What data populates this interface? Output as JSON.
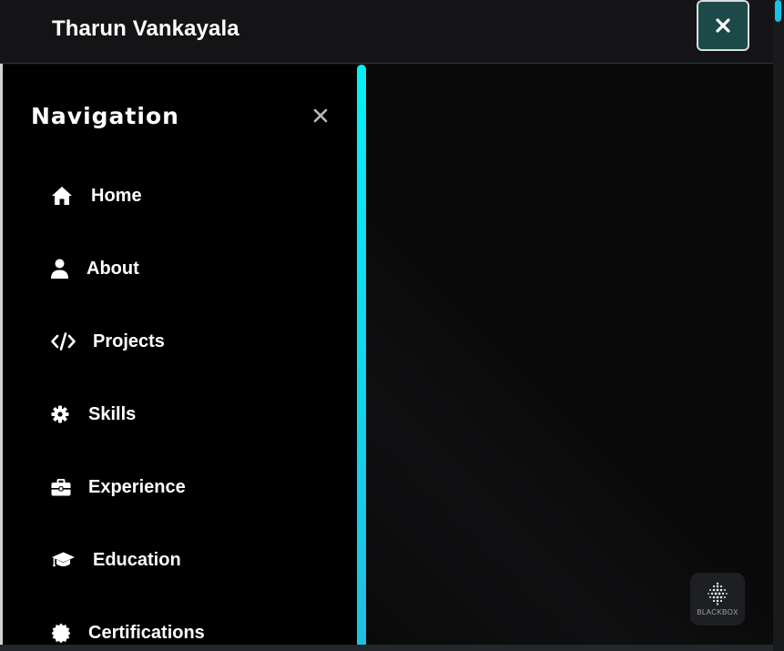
{
  "header": {
    "title": "Tharun Vankayala",
    "close_icon": "close-icon"
  },
  "sidebar": {
    "heading": "Navigation",
    "close_icon": "close-icon",
    "items": [
      {
        "label": "Home",
        "icon": "home-icon"
      },
      {
        "label": "About",
        "icon": "user-icon"
      },
      {
        "label": "Projects",
        "icon": "code-icon"
      },
      {
        "label": "Skills",
        "icon": "gear-icon"
      },
      {
        "label": "Experience",
        "icon": "briefcase-icon"
      },
      {
        "label": "Education",
        "icon": "graduation-cap-icon"
      },
      {
        "label": "Certifications",
        "icon": "certificate-icon"
      }
    ]
  },
  "badge": {
    "label": "BLACKBOX",
    "icon": "blackbox-logo-icon"
  },
  "colors": {
    "accent": "#06f0f7",
    "header_bg": "#141416",
    "close_button_bg": "#1d4a48",
    "sidebar_bg": "#000000"
  }
}
